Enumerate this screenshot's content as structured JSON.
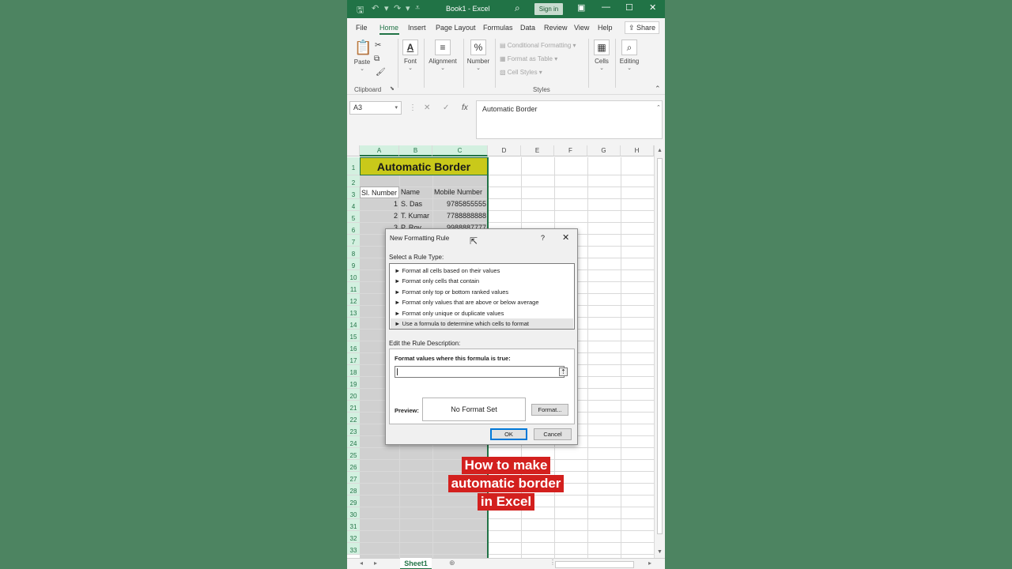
{
  "window": {
    "title": "Book1  -  Excel",
    "sign_in": "Sign in",
    "qa_icons": [
      "save-icon",
      "undo-icon",
      "redo-icon",
      "customize-icon"
    ],
    "controls": [
      "ribbon-display-icon",
      "minimize-icon",
      "maximize-icon",
      "close-icon"
    ]
  },
  "ribbon": {
    "tabs": [
      "File",
      "Home",
      "Insert",
      "Page Layout",
      "Formulas",
      "Data",
      "Review",
      "View",
      "Help"
    ],
    "active_tab": "Home",
    "share": "Share",
    "paste": "Paste",
    "clipboard": "Clipboard",
    "font": "Font",
    "alignment": "Alignment",
    "number": "Number",
    "conditional_formatting": "Conditional Formatting",
    "format_as_table": "Format as Table",
    "cell_styles": "Cell Styles",
    "styles": "Styles",
    "cells": "Cells",
    "editing": "Editing"
  },
  "formula_bar": {
    "name_box": "A3",
    "content": "Automatic Border"
  },
  "sheet": {
    "columns": [
      "A",
      "B",
      "C",
      "D",
      "E",
      "F",
      "G",
      "H"
    ],
    "rows": [
      "1",
      "2",
      "3",
      "4",
      "5",
      "6",
      "7",
      "8",
      "9",
      "10",
      "11",
      "12",
      "13",
      "14",
      "15",
      "16",
      "17",
      "18",
      "19",
      "20",
      "21",
      "22",
      "23",
      "24",
      "25",
      "26",
      "27",
      "28",
      "29",
      "30",
      "31",
      "32",
      "33"
    ],
    "title": "Automatic Border",
    "headers": [
      "Sl. Number",
      "Name",
      "Mobile Number"
    ],
    "data": [
      [
        "1",
        "S. Das",
        "9785855555"
      ],
      [
        "2",
        "T. Kumar",
        "7788888888"
      ],
      [
        "3",
        "P. Roy",
        "9988887777"
      ]
    ],
    "tab_name": "Sheet1"
  },
  "dialog": {
    "title": "New Formatting Rule",
    "help": "?",
    "close": "✕",
    "select_label": "Select a Rule Type:",
    "rule_types": [
      "► Format all cells based on their values",
      "► Format only cells that contain",
      "► Format only top or bottom ranked values",
      "► Format only values that are above or below average",
      "► Format only unique or duplicate values",
      "► Use a formula to determine which cells to format"
    ],
    "selected_rule": 5,
    "edit_label": "Edit the Rule Description:",
    "formula_label": "Format values where this formula is true:",
    "formula_value": "",
    "preview_label": "Preview:",
    "preview_text": "No Format Set",
    "format_button": "Format...",
    "ok": "OK",
    "cancel": "Cancel"
  },
  "caption": {
    "lines": [
      "How to make",
      "automatic border",
      "in Excel"
    ]
  }
}
